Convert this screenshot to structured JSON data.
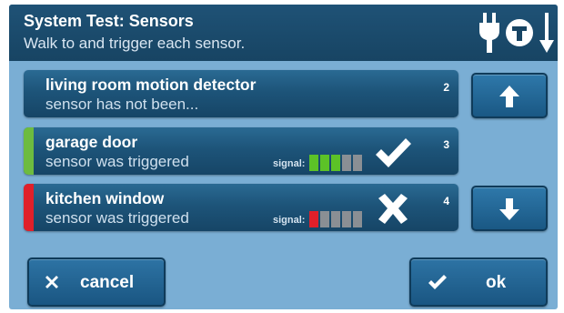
{
  "header": {
    "title": "System Test: Sensors",
    "subtitle": "Walk to and trigger each sensor.",
    "icons": [
      "plug-icon",
      "test-icon",
      "arrow-down-icon"
    ]
  },
  "sensors": [
    {
      "name": "living room motion detector",
      "status": "sensor has not been...",
      "number": "2",
      "signal_label": "",
      "signal_strength": null,
      "result": null,
      "status_color": null
    },
    {
      "name": "garage door",
      "status": "sensor was triggered",
      "number": "3",
      "signal_label": "signal:",
      "signal_strength": 3,
      "signal_max": 5,
      "result": "check-icon",
      "status_color": "#6dbb3f"
    },
    {
      "name": "kitchen window",
      "status": "sensor was triggered",
      "number": "4",
      "signal_label": "signal:",
      "signal_strength": 1,
      "signal_max": 5,
      "result": "x-icon",
      "status_color": "#e0202a"
    }
  ],
  "scroll": {
    "up_icon": "arrow-up-icon",
    "down_icon": "arrow-down-icon"
  },
  "footer": {
    "cancel_label": "cancel",
    "ok_label": "ok"
  },
  "colors": {
    "signal_good": "#5cc227",
    "signal_bad": "#e0202a",
    "signal_empty": "#8a8f94"
  }
}
